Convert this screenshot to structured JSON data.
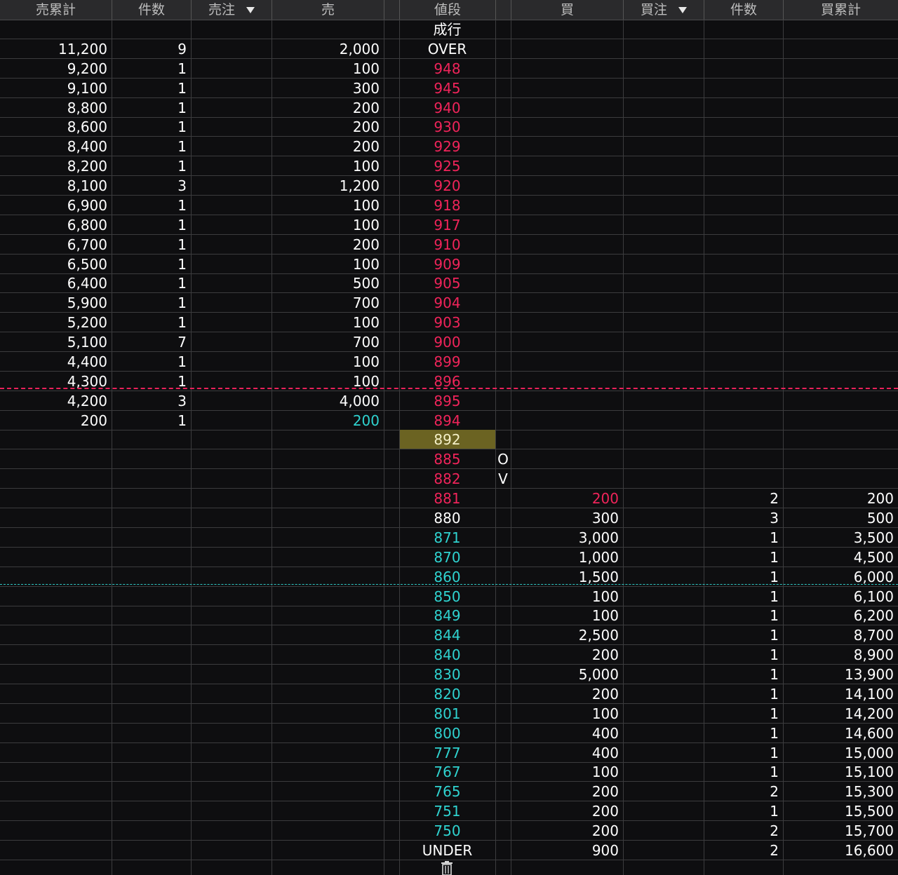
{
  "header": {
    "sell_cum": "売累計",
    "sell_count": "件数",
    "sell_order": "売注",
    "sell": "売",
    "price": "値段",
    "buy": "買",
    "buy_order": "買注",
    "buy_count": "件数",
    "buy_cum": "買累計"
  },
  "colors": {
    "sell_price": "#f0245a",
    "buy_price": "#2fd3d0",
    "current_bg": "#6b6322",
    "background": "#0e0e10"
  },
  "rows": [
    {
      "price": "成行",
      "pc": "white",
      "sc": "",
      "sn": "",
      "s": "",
      "b": "",
      "bn": "",
      "bc": ""
    },
    {
      "price": "OVER",
      "pc": "white",
      "sc": "11,200",
      "sn": "9",
      "s": "2,000",
      "b": "",
      "bn": "",
      "bc": ""
    },
    {
      "price": "948",
      "pc": "red",
      "sc": "9,200",
      "sn": "1",
      "s": "100",
      "b": "",
      "bn": "",
      "bc": ""
    },
    {
      "price": "945",
      "pc": "red",
      "sc": "9,100",
      "sn": "1",
      "s": "300",
      "b": "",
      "bn": "",
      "bc": ""
    },
    {
      "price": "940",
      "pc": "red",
      "sc": "8,800",
      "sn": "1",
      "s": "200",
      "b": "",
      "bn": "",
      "bc": ""
    },
    {
      "price": "930",
      "pc": "red",
      "sc": "8,600",
      "sn": "1",
      "s": "200",
      "b": "",
      "bn": "",
      "bc": ""
    },
    {
      "price": "929",
      "pc": "red",
      "sc": "8,400",
      "sn": "1",
      "s": "200",
      "b": "",
      "bn": "",
      "bc": ""
    },
    {
      "price": "925",
      "pc": "red",
      "sc": "8,200",
      "sn": "1",
      "s": "100",
      "b": "",
      "bn": "",
      "bc": ""
    },
    {
      "price": "920",
      "pc": "red",
      "sc": "8,100",
      "sn": "3",
      "s": "1,200",
      "b": "",
      "bn": "",
      "bc": ""
    },
    {
      "price": "918",
      "pc": "red",
      "sc": "6,900",
      "sn": "1",
      "s": "100",
      "b": "",
      "bn": "",
      "bc": ""
    },
    {
      "price": "917",
      "pc": "red",
      "sc": "6,800",
      "sn": "1",
      "s": "100",
      "b": "",
      "bn": "",
      "bc": ""
    },
    {
      "price": "910",
      "pc": "red",
      "sc": "6,700",
      "sn": "1",
      "s": "200",
      "b": "",
      "bn": "",
      "bc": ""
    },
    {
      "price": "909",
      "pc": "red",
      "sc": "6,500",
      "sn": "1",
      "s": "100",
      "b": "",
      "bn": "",
      "bc": ""
    },
    {
      "price": "905",
      "pc": "red",
      "sc": "6,400",
      "sn": "1",
      "s": "500",
      "b": "",
      "bn": "",
      "bc": ""
    },
    {
      "price": "904",
      "pc": "red",
      "sc": "5,900",
      "sn": "1",
      "s": "700",
      "b": "",
      "bn": "",
      "bc": ""
    },
    {
      "price": "903",
      "pc": "red",
      "sc": "5,200",
      "sn": "1",
      "s": "100",
      "b": "",
      "bn": "",
      "bc": ""
    },
    {
      "price": "900",
      "pc": "red",
      "sc": "5,100",
      "sn": "7",
      "s": "700",
      "b": "",
      "bn": "",
      "bc": ""
    },
    {
      "price": "899",
      "pc": "red",
      "sc": "4,400",
      "sn": "1",
      "s": "100",
      "b": "",
      "bn": "",
      "bc": ""
    },
    {
      "price": "896",
      "pc": "red",
      "sc": "4,300",
      "sn": "1",
      "s": "100",
      "b": "",
      "bn": "",
      "bc": ""
    },
    {
      "price": "895",
      "pc": "red",
      "sc": "4,200",
      "sn": "3",
      "s": "4,000",
      "b": "",
      "bn": "",
      "bc": ""
    },
    {
      "price": "894",
      "pc": "red",
      "sc": "200",
      "sn": "1",
      "s": "200",
      "sColor": "cyan",
      "b": "",
      "bn": "",
      "bc": ""
    },
    {
      "price": "892",
      "pc": "current",
      "sc": "",
      "sn": "",
      "s": "",
      "b": "",
      "bn": "",
      "bc": ""
    },
    {
      "price": "885",
      "pc": "red",
      "mark": "O",
      "sc": "",
      "sn": "",
      "s": "",
      "b": "",
      "bn": "",
      "bc": ""
    },
    {
      "price": "882",
      "pc": "red",
      "mark": "V",
      "sc": "",
      "sn": "",
      "s": "",
      "b": "",
      "bn": "",
      "bc": ""
    },
    {
      "price": "881",
      "pc": "red",
      "sc": "",
      "sn": "",
      "s": "",
      "b": "200",
      "bColor": "red",
      "bn": "2",
      "bc": "200"
    },
    {
      "price": "880",
      "pc": "white",
      "sc": "",
      "sn": "",
      "s": "",
      "b": "300",
      "bn": "3",
      "bc": "500"
    },
    {
      "price": "871",
      "pc": "cyan",
      "sc": "",
      "sn": "",
      "s": "",
      "b": "3,000",
      "bn": "1",
      "bc": "3,500"
    },
    {
      "price": "870",
      "pc": "cyan",
      "sc": "",
      "sn": "",
      "s": "",
      "b": "1,000",
      "bn": "1",
      "bc": "4,500"
    },
    {
      "price": "860",
      "pc": "cyan",
      "sc": "",
      "sn": "",
      "s": "",
      "b": "1,500",
      "bn": "1",
      "bc": "6,000"
    },
    {
      "price": "850",
      "pc": "cyan",
      "sc": "",
      "sn": "",
      "s": "",
      "b": "100",
      "bn": "1",
      "bc": "6,100"
    },
    {
      "price": "849",
      "pc": "cyan",
      "sc": "",
      "sn": "",
      "s": "",
      "b": "100",
      "bn": "1",
      "bc": "6,200"
    },
    {
      "price": "844",
      "pc": "cyan",
      "sc": "",
      "sn": "",
      "s": "",
      "b": "2,500",
      "bn": "1",
      "bc": "8,700"
    },
    {
      "price": "840",
      "pc": "cyan",
      "sc": "",
      "sn": "",
      "s": "",
      "b": "200",
      "bn": "1",
      "bc": "8,900"
    },
    {
      "price": "830",
      "pc": "cyan",
      "sc": "",
      "sn": "",
      "s": "",
      "b": "5,000",
      "bn": "1",
      "bc": "13,900"
    },
    {
      "price": "820",
      "pc": "cyan",
      "sc": "",
      "sn": "",
      "s": "",
      "b": "200",
      "bn": "1",
      "bc": "14,100"
    },
    {
      "price": "801",
      "pc": "cyan",
      "sc": "",
      "sn": "",
      "s": "",
      "b": "100",
      "bn": "1",
      "bc": "14,200"
    },
    {
      "price": "800",
      "pc": "cyan",
      "sc": "",
      "sn": "",
      "s": "",
      "b": "400",
      "bn": "1",
      "bc": "14,600"
    },
    {
      "price": "777",
      "pc": "cyan",
      "sc": "",
      "sn": "",
      "s": "",
      "b": "400",
      "bn": "1",
      "bc": "15,000"
    },
    {
      "price": "767",
      "pc": "cyan",
      "sc": "",
      "sn": "",
      "s": "",
      "b": "100",
      "bn": "1",
      "bc": "15,100"
    },
    {
      "price": "765",
      "pc": "cyan",
      "sc": "",
      "sn": "",
      "s": "",
      "b": "200",
      "bn": "2",
      "bc": "15,300"
    },
    {
      "price": "751",
      "pc": "cyan",
      "sc": "",
      "sn": "",
      "s": "",
      "b": "200",
      "bn": "1",
      "bc": "15,500"
    },
    {
      "price": "750",
      "pc": "cyan",
      "sc": "",
      "sn": "",
      "s": "",
      "b": "200",
      "bn": "2",
      "bc": "15,700"
    },
    {
      "price": "UNDER",
      "pc": "white",
      "sc": "",
      "sn": "",
      "s": "",
      "b": "900",
      "bn": "2",
      "bc": "16,600"
    }
  ],
  "footer_icon": "trash-icon"
}
